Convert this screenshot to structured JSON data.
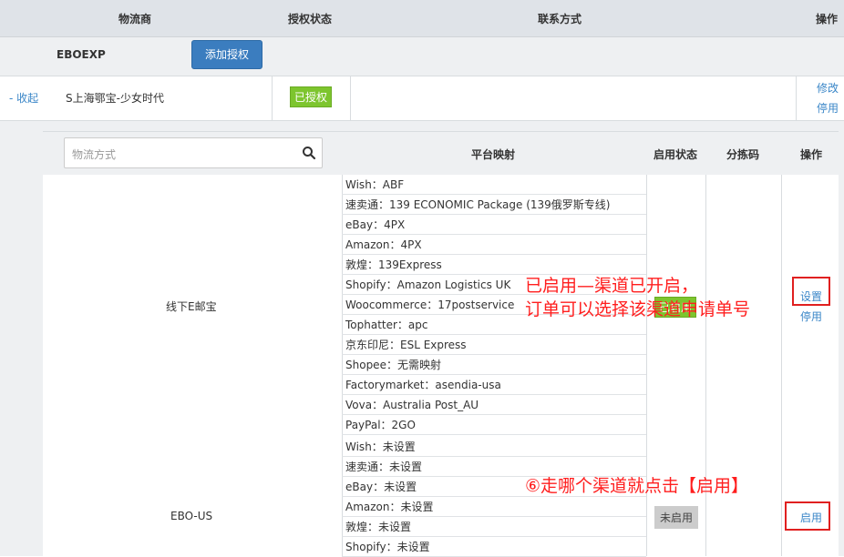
{
  "header": {
    "col_provider": "物流商",
    "col_auth": "授权状态",
    "col_contact": "联系方式",
    "col_ops": "操作"
  },
  "provider": {
    "name": "EBOEXP",
    "add_auth_button": "添加授权"
  },
  "account": {
    "collapse_link": "- 收起",
    "name": "S上海鄂宝-少女时代",
    "auth_status": "已授权",
    "edit_link": "修改",
    "disable_link": "停用"
  },
  "inner_table": {
    "search_placeholder": "物流方式",
    "col_mapping": "平台映射",
    "col_status": "启用状态",
    "col_sort_code": "分拣码",
    "col_ops": "操作"
  },
  "channels": [
    {
      "name": "线下E邮宝",
      "mappings": [
        "Wish：ABF",
        "速卖通：139 ECONOMIC Package (139俄罗斯专线)",
        "eBay：4PX",
        "Amazon：4PX",
        "敦煌：139Express",
        "Shopify：Amazon Logistics UK",
        "Woocommerce：17postservice",
        "Tophatter：apc",
        "京东印尼：ESL Express",
        "Shopee：无需映射",
        "Factorymarket：asendia-usa",
        "Vova：Australia Post_AU",
        "PayPal：2GO"
      ],
      "status": "已启用",
      "settings_link": "设置",
      "disable_link": "停用"
    },
    {
      "name": "EBO-US",
      "mappings": [
        "Wish：未设置",
        "速卖通：未设置",
        "eBay：未设置",
        "Amazon：未设置",
        "敦煌：未设置",
        "Shopify：未设置"
      ],
      "status": "未启用",
      "enable_link": "启用"
    }
  ],
  "annotations": {
    "note1_line1": "已启用—渠道已开启，",
    "note1_line2": "订单可以选择该渠道申请单号",
    "note2": "⑥走哪个渠道就点击【启用】"
  },
  "colors": {
    "primary_button": "#3b7dbf",
    "enabled_badge": "#7dc52e",
    "link": "#3b87c8",
    "annotation": "#ff1e1e"
  }
}
